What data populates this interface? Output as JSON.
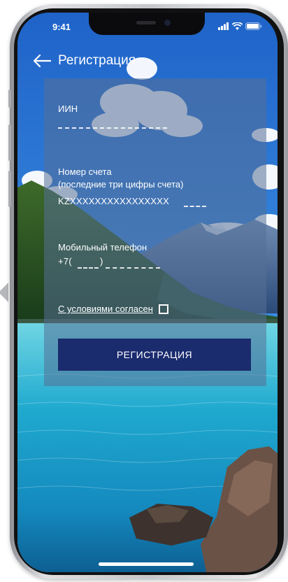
{
  "status_bar": {
    "time": "9:41"
  },
  "header": {
    "title": "Регистрация"
  },
  "form": {
    "iin_label": "ИИН",
    "account_label": "Номер счета",
    "account_hint": "(последние три цифры счета)",
    "account_prefix": "KZXXXXXXXXXXXXXXXX",
    "phone_label": "Мобильный телефон",
    "phone_prefix": "+7(",
    "phone_close": ")",
    "agree_text": "С условиями согласен",
    "agree_checked": false,
    "submit_label": "РЕГИСТРАЦИЯ"
  },
  "colors": {
    "button": "#1a2b6e",
    "panel": "#56709680",
    "text": "#ffffff"
  },
  "icons": [
    "back-arrow-icon",
    "signal-icon",
    "wifi-icon",
    "battery-icon",
    "chevron-left-icon"
  ]
}
